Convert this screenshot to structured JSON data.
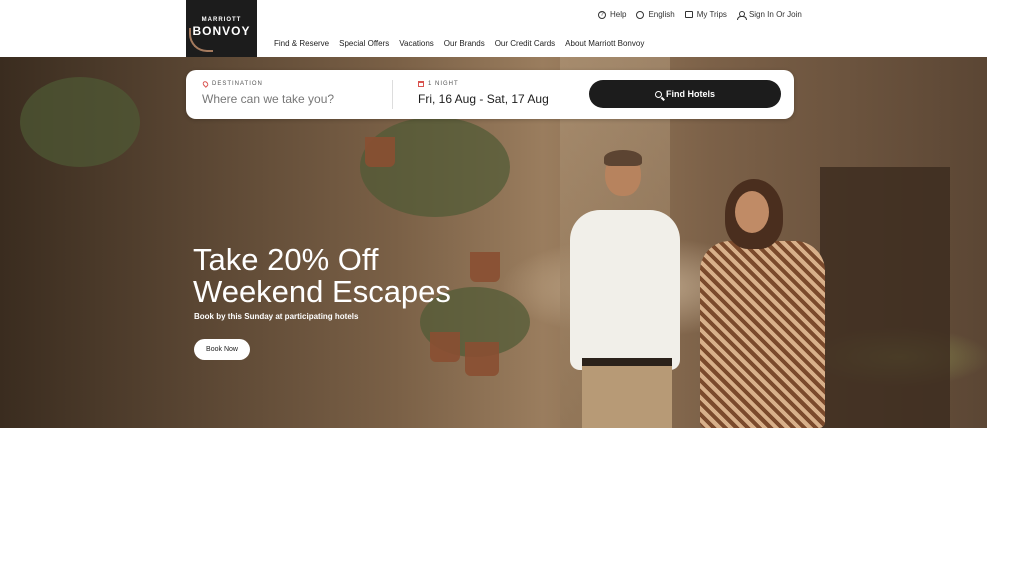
{
  "logo": {
    "line1": "MARRIOTT",
    "line2": "BONVOY"
  },
  "utility": [
    {
      "label": "Help",
      "icon": "help-circle-icon"
    },
    {
      "label": "English",
      "icon": "globe-icon"
    },
    {
      "label": "My Trips",
      "icon": "suitcase-icon"
    },
    {
      "label": "Sign In Or Join",
      "icon": "user-icon"
    }
  ],
  "nav": [
    "Find & Reserve",
    "Special Offers",
    "Vacations",
    "Our Brands",
    "Our Credit Cards",
    "About Marriott Bonvoy"
  ],
  "search": {
    "destination_label": "DESTINATION",
    "destination_placeholder": "Where can we take you?",
    "nights_label": "1 NIGHT",
    "dates_value": "Fri, 16 Aug - Sat, 17 Aug",
    "find_label": "Find Hotels"
  },
  "hero": {
    "title_line1": "Take 20% Off",
    "title_line2": "Weekend Escapes",
    "subtitle": "Book by this Sunday at participating hotels",
    "cta": "Book Now"
  },
  "colors": {
    "brand_dark": "#1c1c1c",
    "accent": "#d9534f"
  }
}
